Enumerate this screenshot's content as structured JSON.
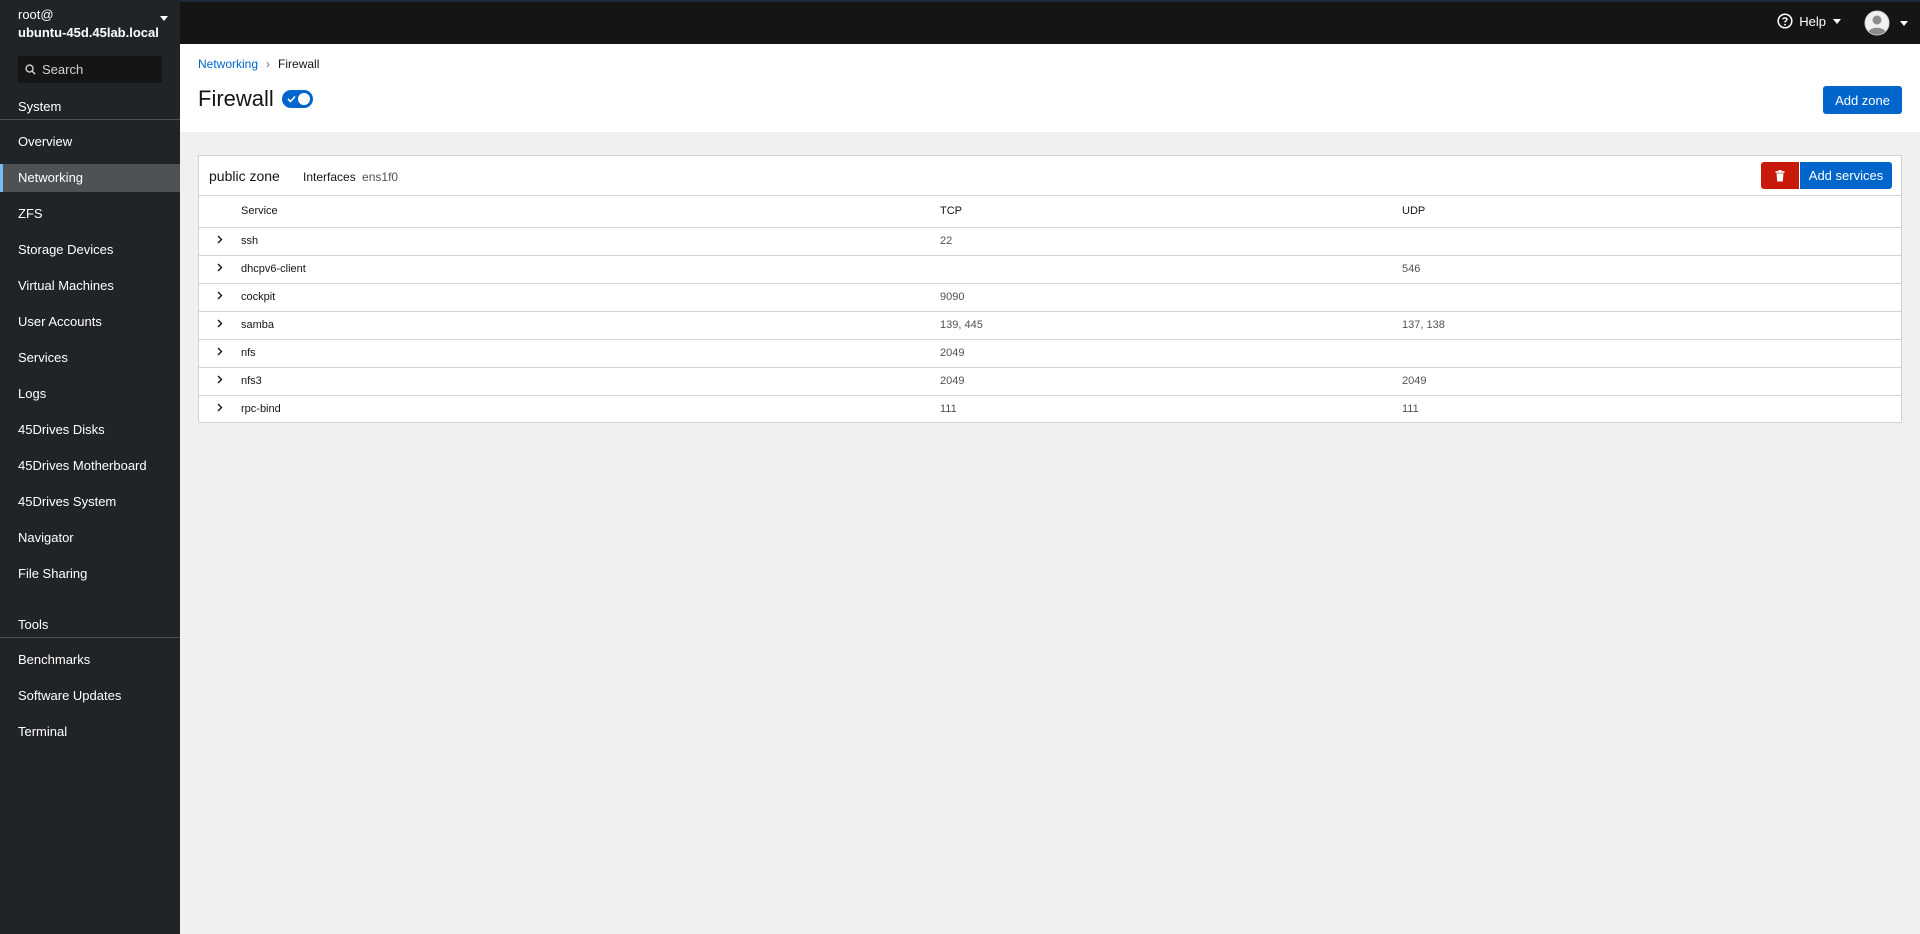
{
  "sidebar": {
    "host_user": "root@",
    "host_name": "ubuntu-45d.45lab.local",
    "search_placeholder": "Search",
    "system_section": "System",
    "system_items": [
      {
        "label": "Overview"
      },
      {
        "label": "Networking",
        "active": true
      },
      {
        "label": "ZFS"
      },
      {
        "label": "Storage Devices"
      },
      {
        "label": "Virtual Machines"
      },
      {
        "label": "User Accounts"
      },
      {
        "label": "Services"
      },
      {
        "label": "Logs"
      },
      {
        "label": "45Drives Disks"
      },
      {
        "label": "45Drives Motherboard"
      },
      {
        "label": "45Drives System"
      },
      {
        "label": "Navigator"
      },
      {
        "label": "File Sharing"
      }
    ],
    "tools_section": "Tools",
    "tools_items": [
      {
        "label": "Benchmarks"
      },
      {
        "label": "Software Updates"
      },
      {
        "label": "Terminal"
      }
    ]
  },
  "topbar": {
    "help_label": "Help"
  },
  "header": {
    "breadcrumb_parent": "Networking",
    "breadcrumb_current": "Firewall",
    "title": "Firewall",
    "firewall_enabled": true,
    "add_zone_label": "Add zone"
  },
  "zone": {
    "name": "public zone",
    "interfaces_label": "Interfaces",
    "interfaces_value": "ens1f0",
    "add_services_label": "Add services",
    "columns": {
      "service": "Service",
      "tcp": "TCP",
      "udp": "UDP"
    },
    "services": [
      {
        "name": "ssh",
        "tcp": "22",
        "udp": ""
      },
      {
        "name": "dhcpv6-client",
        "tcp": "",
        "udp": "546"
      },
      {
        "name": "cockpit",
        "tcp": "9090",
        "udp": ""
      },
      {
        "name": "samba",
        "tcp": "139, 445",
        "udp": "137, 138"
      },
      {
        "name": "nfs",
        "tcp": "2049",
        "udp": ""
      },
      {
        "name": "nfs3",
        "tcp": "2049",
        "udp": "2049"
      },
      {
        "name": "rpc-bind",
        "tcp": "111",
        "udp": "111"
      }
    ]
  },
  "colors": {
    "sidebar_bg": "#212427",
    "topbar_bg": "#151515",
    "primary": "#0066cc",
    "danger": "#c9190b",
    "active_indicator": "#73bcf7"
  }
}
